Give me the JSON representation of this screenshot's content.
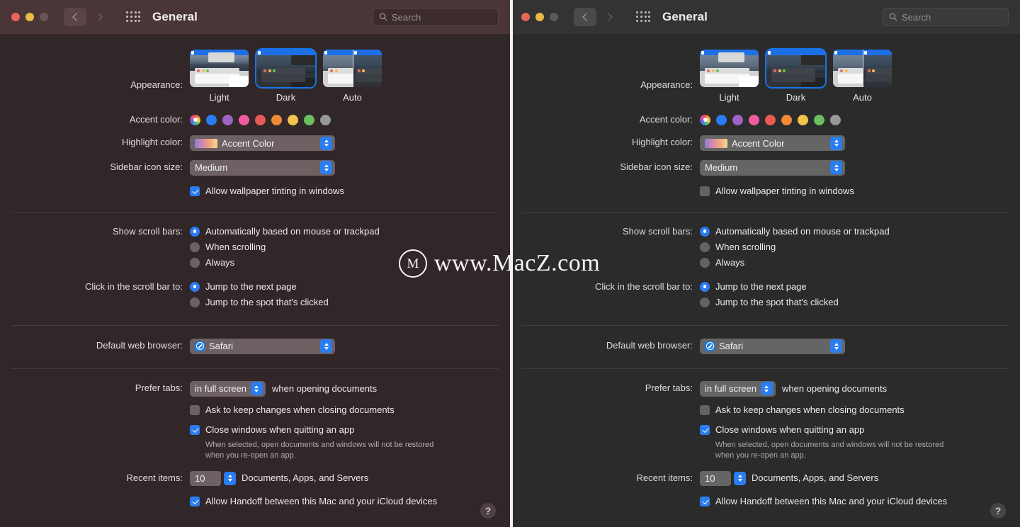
{
  "window": {
    "title": "General",
    "traffic_lights": [
      "close",
      "minimize",
      "zoom"
    ],
    "nav_back_icon": "chevron-left-icon",
    "nav_forward_icon": "chevron-right-icon",
    "grid_icon": "grid-of-dots-icon",
    "search": {
      "placeholder": "Search",
      "value": "",
      "icon": "search-icon"
    },
    "help_label": "?"
  },
  "labels": {
    "appearance": "Appearance:",
    "accent_color": "Accent color:",
    "highlight_color": "Highlight color:",
    "sidebar_icon_size": "Sidebar icon size:",
    "show_scroll_bars": "Show scroll bars:",
    "click_scroll_bar": "Click in the scroll bar to:",
    "default_web_browser": "Default web browser:",
    "prefer_tabs": "Prefer tabs:",
    "recent_items": "Recent items:"
  },
  "appearance": {
    "options": [
      {
        "label": "Light",
        "selected": false
      },
      {
        "label": "Dark",
        "selected": true
      },
      {
        "label": "Auto",
        "selected": false
      }
    ]
  },
  "accent_colors": {
    "selected_index": 0,
    "swatches": [
      {
        "name": "multicolor",
        "color": "multicolor"
      },
      {
        "name": "blue",
        "color": "#2a7df0"
      },
      {
        "name": "purple",
        "color": "#a063c4"
      },
      {
        "name": "pink",
        "color": "#ef5ba0"
      },
      {
        "name": "red",
        "color": "#ea5a54"
      },
      {
        "name": "orange",
        "color": "#ef8a37"
      },
      {
        "name": "yellow",
        "color": "#f2c councils"
      },
      {
        "name": "green",
        "color": "#6cbf5e"
      },
      {
        "name": "graphite",
        "color": "#989898"
      }
    ]
  },
  "highlight_color": {
    "value": "Accent Color",
    "swatch": "gradient"
  },
  "sidebar_icon_size": {
    "value": "Medium"
  },
  "wallpaper_tinting": {
    "label": "Allow wallpaper tinting in windows",
    "left_checked": true,
    "right_checked": false
  },
  "scroll_bars": {
    "options": [
      "Automatically based on mouse or trackpad",
      "When scrolling",
      "Always"
    ],
    "selected_index": 0
  },
  "scroll_bar_click": {
    "options": [
      "Jump to the next page",
      "Jump to the spot that's clicked"
    ],
    "selected_index": 0
  },
  "default_browser": {
    "value": "Safari",
    "icon": "safari-icon"
  },
  "prefer_tabs": {
    "value": "in full screen",
    "suffix": "when opening documents"
  },
  "ask_keep_changes": {
    "label": "Ask to keep changes when closing documents",
    "checked": false
  },
  "close_windows": {
    "label": "Close windows when quitting an app",
    "checked": true,
    "hint_line1": "When selected, open documents and windows will not be restored",
    "hint_line2": "when you re-open an app."
  },
  "recent_items": {
    "value": "10",
    "suffix": "Documents, Apps, and Servers"
  },
  "handoff": {
    "label": "Allow Handoff between this Mac and your iCloud devices",
    "checked": true
  },
  "watermark": {
    "logo": "M",
    "text": "www.MacZ.com"
  },
  "colors": {
    "accent_blue": "#2a7df0",
    "tinted_bg": "#312728",
    "plain_bg": "#2b2b2b",
    "tinted_titlebar": "#4a3537",
    "plain_titlebar": "#333333"
  }
}
